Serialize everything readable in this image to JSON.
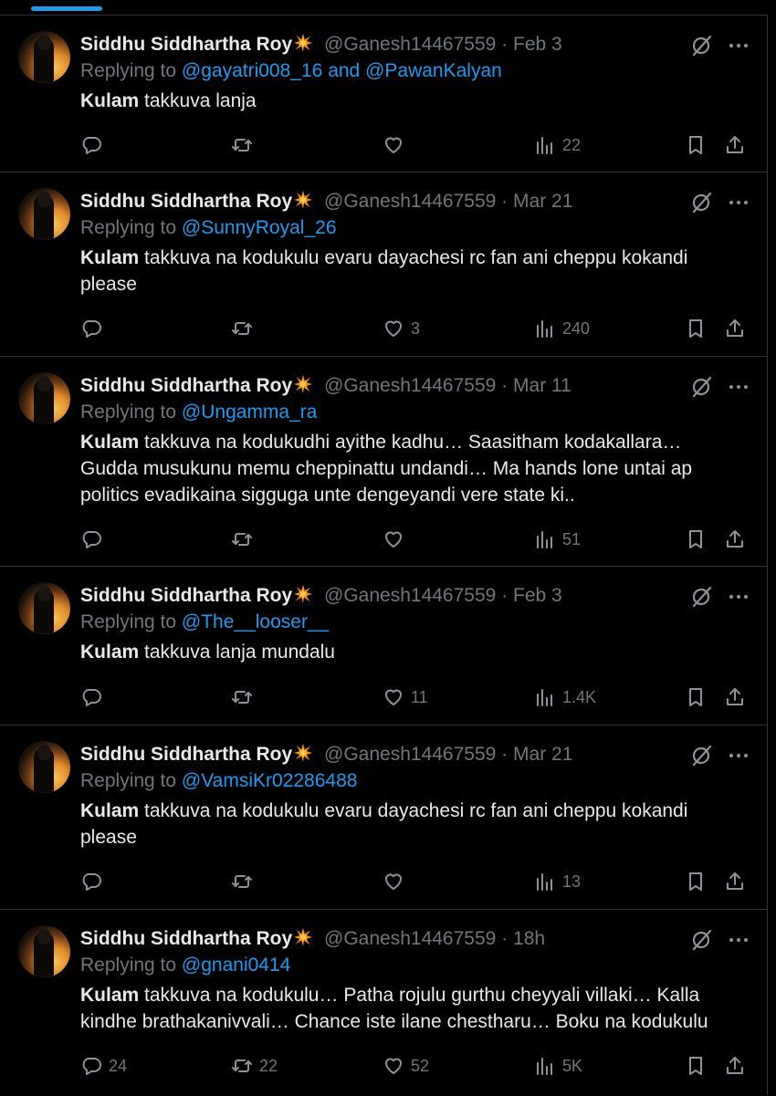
{
  "colors": {
    "background": "#000000",
    "text": "#e7e9ea",
    "secondary": "#71767b",
    "accent": "#1d9bf0",
    "divider": "#2f3336"
  },
  "tweets": [
    {
      "name": "Siddhu Siddhartha Roy",
      "badge_icon": "collision-emoji",
      "handle": "@Ganesh14467559",
      "sep": "·",
      "time": "Feb 3",
      "replying_prefix": "Replying to",
      "mentions": [
        "@gayatri008_16",
        "@PawanKalyan"
      ],
      "mention_joiner": "and",
      "text_bold": "Kulam",
      "text_rest": " takkuva lanja",
      "reply_count": "",
      "retweet_count": "",
      "like_count": "",
      "view_count": "22"
    },
    {
      "name": "Siddhu Siddhartha Roy",
      "badge_icon": "collision-emoji",
      "handle": "@Ganesh14467559",
      "sep": "·",
      "time": "Mar 21",
      "replying_prefix": "Replying to",
      "mentions": [
        "@SunnyRoyal_26"
      ],
      "text_bold": "Kulam",
      "text_rest": " takkuva na kodukulu evaru dayachesi rc fan ani cheppu kokandi please",
      "reply_count": "",
      "retweet_count": "",
      "like_count": "3",
      "view_count": "240"
    },
    {
      "name": "Siddhu Siddhartha Roy",
      "badge_icon": "collision-emoji",
      "handle": "@Ganesh14467559",
      "sep": "·",
      "time": "Mar 11",
      "replying_prefix": "Replying to",
      "mentions": [
        "@Ungamma_ra"
      ],
      "text_bold": "Kulam",
      "text_rest": " takkuva na kodukudhi ayithe kadhu… Saasitham kodakallara… Gudda musukunu memu cheppinattu undandi… Ma hands lone untai ap politics evadikaina sigguga unte dengeyandi vere state ki..",
      "reply_count": "",
      "retweet_count": "",
      "like_count": "",
      "view_count": "51"
    },
    {
      "name": "Siddhu Siddhartha Roy",
      "badge_icon": "collision-emoji",
      "handle": "@Ganesh14467559",
      "sep": "·",
      "time": "Feb 3",
      "replying_prefix": "Replying to",
      "mentions": [
        "@The__looser__"
      ],
      "text_bold": "Kulam",
      "text_rest": " takkuva lanja mundalu",
      "reply_count": "",
      "retweet_count": "",
      "like_count": "11",
      "view_count": "1.4K"
    },
    {
      "name": "Siddhu Siddhartha Roy",
      "badge_icon": "collision-emoji",
      "handle": "@Ganesh14467559",
      "sep": "·",
      "time": "Mar 21",
      "replying_prefix": "Replying to",
      "mentions": [
        "@VamsiKr02286488"
      ],
      "text_bold": "Kulam",
      "text_rest": " takkuva na kodukulu evaru dayachesi rc fan ani cheppu kokandi please",
      "reply_count": "",
      "retweet_count": "",
      "like_count": "",
      "view_count": "13"
    },
    {
      "name": "Siddhu Siddhartha Roy",
      "badge_icon": "collision-emoji",
      "handle": "@Ganesh14467559",
      "sep": "·",
      "time": "18h",
      "replying_prefix": "Replying to",
      "mentions": [
        "@gnani0414"
      ],
      "text_bold": "Kulam",
      "text_rest": " takkuva na kodukulu… Patha rojulu gurthu cheyyali villaki… Kalla kindhe brathakanivvali… Chance iste ilane chestharu… Boku na kodukulu",
      "reply_count": "24",
      "retweet_count": "22",
      "like_count": "52",
      "view_count": "5K"
    }
  ]
}
